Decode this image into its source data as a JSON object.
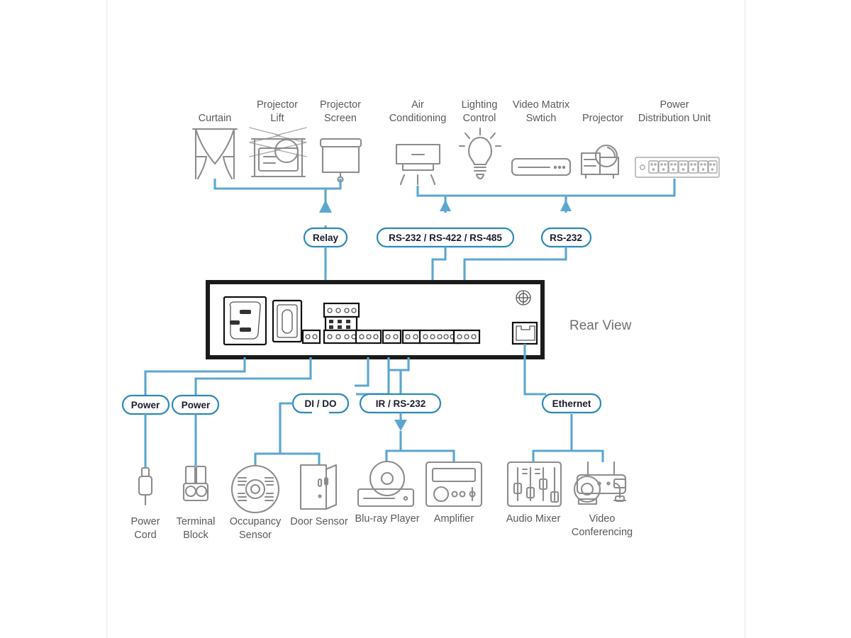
{
  "diagram": {
    "title": "Rear View",
    "rear_view_label": "Rear View",
    "colors": {
      "wire": "#5ba7d0",
      "pill_border": "#2d8ab5",
      "pill_text": "#1b1b2f",
      "icon_stroke": "#8c8c8e",
      "label_text": "#58595b",
      "panel_stroke": "#1a1a1a",
      "background": "#ffffff"
    }
  },
  "top_devices": [
    {
      "id": "curtain",
      "label": "Curtain",
      "icon": "curtain-icon"
    },
    {
      "id": "projector-lift",
      "label": "Projector\nLift",
      "line1": "Projector",
      "line2": "Lift",
      "icon": "projector-lift-icon"
    },
    {
      "id": "projector-screen",
      "label": "Projector\nScreen",
      "line1": "Projector",
      "line2": "Screen",
      "icon": "projector-screen-icon"
    },
    {
      "id": "air-conditioning",
      "label": "Air\nConditioning",
      "line1": "Air",
      "line2": "Conditioning",
      "icon": "air-conditioner-icon"
    },
    {
      "id": "lighting-control",
      "label": "Lighting\nControl",
      "line1": "Lighting",
      "line2": "Control",
      "icon": "lightbulb-icon"
    },
    {
      "id": "video-matrix-switch",
      "label": "Video Matrix\nSwtich",
      "line1": "Video Matrix",
      "line2": "Swtich",
      "icon": "video-matrix-switch-icon"
    },
    {
      "id": "projector",
      "label": "Projector",
      "icon": "projector-icon"
    },
    {
      "id": "power-distribution-unit",
      "label": "Power\nDistribution Unit",
      "line1": "Power",
      "line2": "Distribution Unit",
      "icon": "power-distribution-unit-icon"
    }
  ],
  "top_connection_labels": [
    {
      "id": "relay",
      "text": "Relay"
    },
    {
      "id": "rs232-rs422-rs485",
      "text": "RS-232 / RS-422 / RS-485"
    },
    {
      "id": "rs232",
      "text": "RS-232"
    }
  ],
  "bottom_connection_labels": [
    {
      "id": "power-1",
      "text": "Power"
    },
    {
      "id": "power-2",
      "text": "Power"
    },
    {
      "id": "di-do",
      "text": "DI / DO"
    },
    {
      "id": "ir-rs232",
      "text": "IR / RS-232"
    },
    {
      "id": "ethernet",
      "text": "Ethernet"
    }
  ],
  "bottom_devices": [
    {
      "id": "power-cord",
      "label": "Power\nCord",
      "line1": "Power",
      "line2": "Cord",
      "icon": "power-cord-icon"
    },
    {
      "id": "terminal-block",
      "label": "Terminal\nBlock",
      "line1": "Terminal",
      "line2": "Block",
      "icon": "terminal-block-icon"
    },
    {
      "id": "occupancy-sensor",
      "label": "Occupancy\nSensor",
      "line1": "Occupancy",
      "line2": "Sensor",
      "icon": "occupancy-sensor-icon"
    },
    {
      "id": "door-sensor",
      "label": "Door Sensor",
      "line1": "Door Sensor",
      "line2": "",
      "icon": "door-sensor-icon"
    },
    {
      "id": "blu-ray-player",
      "label": "Blu-ray Player",
      "line1": "Blu-ray Player",
      "line2": "",
      "icon": "blu-ray-player-icon"
    },
    {
      "id": "amplifier",
      "label": "Amplifier",
      "line1": "Amplifier",
      "line2": "",
      "icon": "amplifier-icon"
    },
    {
      "id": "audio-mixer",
      "label": "Audio Mixer",
      "line1": "Audio Mixer",
      "line2": "",
      "icon": "audio-mixer-icon"
    },
    {
      "id": "video-conferencing",
      "label": "Video\nConferencing",
      "line1": "Video",
      "line2": "Conferencing",
      "icon": "video-conferencing-icon"
    }
  ],
  "rear_panel": {
    "ports": [
      {
        "id": "ac-inlet",
        "name": "ac-power-inlet"
      },
      {
        "id": "power-switch",
        "name": "power-switch"
      },
      {
        "id": "terminal-2pin-a",
        "name": "2-pin-terminal"
      },
      {
        "id": "relay-block",
        "name": "relay-terminal-block"
      },
      {
        "id": "terminal-3pin-a",
        "name": "3-pin-terminal"
      },
      {
        "id": "terminal-2pin-b",
        "name": "2-pin-terminal"
      },
      {
        "id": "terminal-2pin-c",
        "name": "2-pin-terminal"
      },
      {
        "id": "terminal-6pin",
        "name": "6-pin-terminal"
      },
      {
        "id": "terminal-3pin-b",
        "name": "3-pin-terminal"
      },
      {
        "id": "ethernet-jack",
        "name": "rj45-ethernet-jack"
      },
      {
        "id": "ground-screw",
        "name": "grounding-screw"
      }
    ]
  }
}
